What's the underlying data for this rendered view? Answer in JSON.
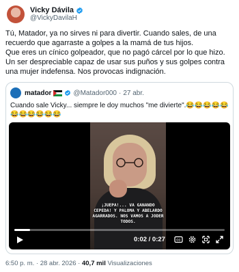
{
  "author": {
    "display_name": "Vicky Dávila",
    "handle": "@VickyDavilaH",
    "verified_badge_icon": "verified-badge-icon"
  },
  "tweet": {
    "paragraphs": [
      "Tú, Matador, ya no sirves ni para divertir. Cuando sales, de una recuerdo que agarraste a golpes a la mamá de tus hijos.",
      "Que eres un cínico golpeador, que no pagó cárcel por lo que hizo. Un ser despreciable capaz de usar sus puños y sus golpes contra una mujer indefensa. Nos provocas indignación."
    ]
  },
  "quote": {
    "display_name": "matador",
    "handle": "@Matador000",
    "separator": "·",
    "time": "27 abr.",
    "text": "Cuando sale Vicky... siempre le doy muchos \"me divierte\".😂😂😂😂😂😂😂😂😂😂😂",
    "video": {
      "caption": "¡JUEPA!... VA GANANDO CEPEDA! Y PALOMA Y ABELARDO AGARRADOS. NOS VAMOS A JODER TODOS.",
      "time_display": "0:02 / 0:27",
      "progress": 0.074,
      "icons": [
        "play-icon",
        "closed-captions-icon",
        "settings-icon",
        "fullscreen-icon",
        "expand-icon"
      ]
    }
  },
  "meta": {
    "time": "6:50 p. m.",
    "separator": "·",
    "date": "28 abr. 2026",
    "views_count": "40,7 mil",
    "views_label": "Visualizaciones"
  },
  "colors": {
    "verified": "#1d9bf0",
    "secondary_text": "#536471",
    "border": "#cfd9de"
  }
}
